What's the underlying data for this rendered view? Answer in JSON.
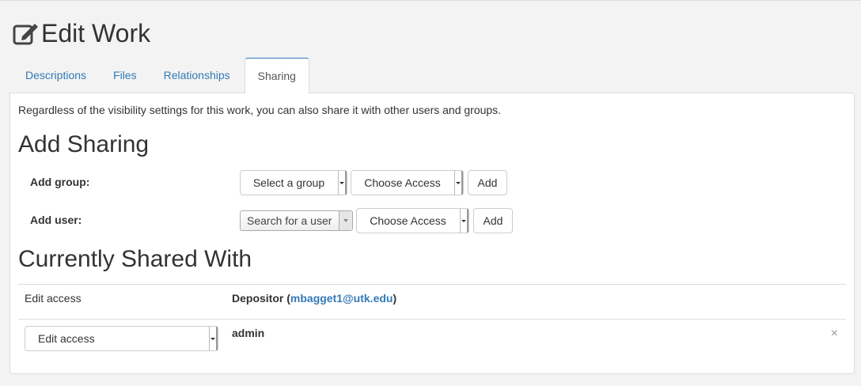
{
  "page": {
    "title": "Edit Work",
    "title_icon": "edit-icon"
  },
  "tabs": [
    {
      "label": "Descriptions"
    },
    {
      "label": "Files"
    },
    {
      "label": "Relationships"
    },
    {
      "label": "Sharing",
      "active": true
    }
  ],
  "sharing": {
    "intro": "Regardless of the visibility settings for this work, you can also share it with other users and groups.",
    "add_heading": "Add Sharing",
    "add_group": {
      "label": "Add group:",
      "group_select": "Select a group",
      "access_select": "Choose Access",
      "add_button": "Add"
    },
    "add_user": {
      "label": "Add user:",
      "user_search": "Search for a user",
      "access_select": "Choose Access",
      "add_button": "Add"
    },
    "shared_heading": "Currently Shared With",
    "shared": [
      {
        "access": "Edit access",
        "name": "Depositor",
        "email": "mbagget1@utk.edu"
      },
      {
        "access": "Edit access",
        "name": "admin",
        "removable": true
      }
    ],
    "remove_symbol": "×"
  },
  "colors": {
    "link": "#337ab7",
    "background": "#f3f3f3",
    "panel": "#ffffff"
  }
}
